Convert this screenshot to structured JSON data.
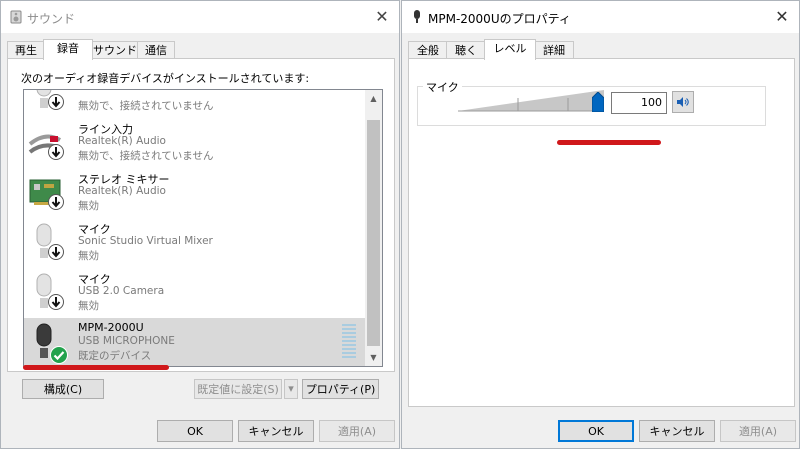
{
  "left_window": {
    "title": "サウンド",
    "close_glyph": "✕",
    "tabs": [
      "再生",
      "録音",
      "サウンド",
      "通信"
    ],
    "active_tab": 1,
    "instructions": "次のオーディオ録音デバイスがインストールされています:",
    "devices": [
      {
        "name": "",
        "driver": "",
        "status": "無効で、接続されていません",
        "icon": "microphone-icon"
      },
      {
        "name": "ライン入力",
        "driver": "Realtek(R) Audio",
        "status": "無効で、接続されていません",
        "icon": "line-in-cable-icon"
      },
      {
        "name": "ステレオ ミキサー",
        "driver": "Realtek(R) Audio",
        "status": "無効",
        "icon": "sound-card-icon"
      },
      {
        "name": "マイク",
        "driver": "Sonic Studio Virtual Mixer",
        "status": "無効",
        "icon": "microphone-icon"
      },
      {
        "name": "マイク",
        "driver": "USB 2.0 Camera",
        "status": "無効",
        "icon": "microphone-icon"
      },
      {
        "name": "MPM-2000U",
        "driver": "USB MICROPHONE",
        "status": "既定のデバイス",
        "icon": "microphone-icon",
        "selected": true
      }
    ],
    "buttons": {
      "configure": "構成(C)",
      "set_default": "既定値に設定(S)",
      "properties": "プロパティ(P)",
      "ok": "OK",
      "cancel": "キャンセル",
      "apply": "適用(A)"
    },
    "highlight_color": "#d0181b"
  },
  "right_window": {
    "title": "MPM-2000Uのプロパティ",
    "close_glyph": "✕",
    "tabs": [
      "全般",
      "聴く",
      "レベル",
      "詳細"
    ],
    "active_tab": 2,
    "level": {
      "label": "マイク",
      "value": "100",
      "slider_fraction": 1.0
    },
    "buttons": {
      "ok": "OK",
      "cancel": "キャンセル",
      "apply": "適用(A)"
    }
  }
}
